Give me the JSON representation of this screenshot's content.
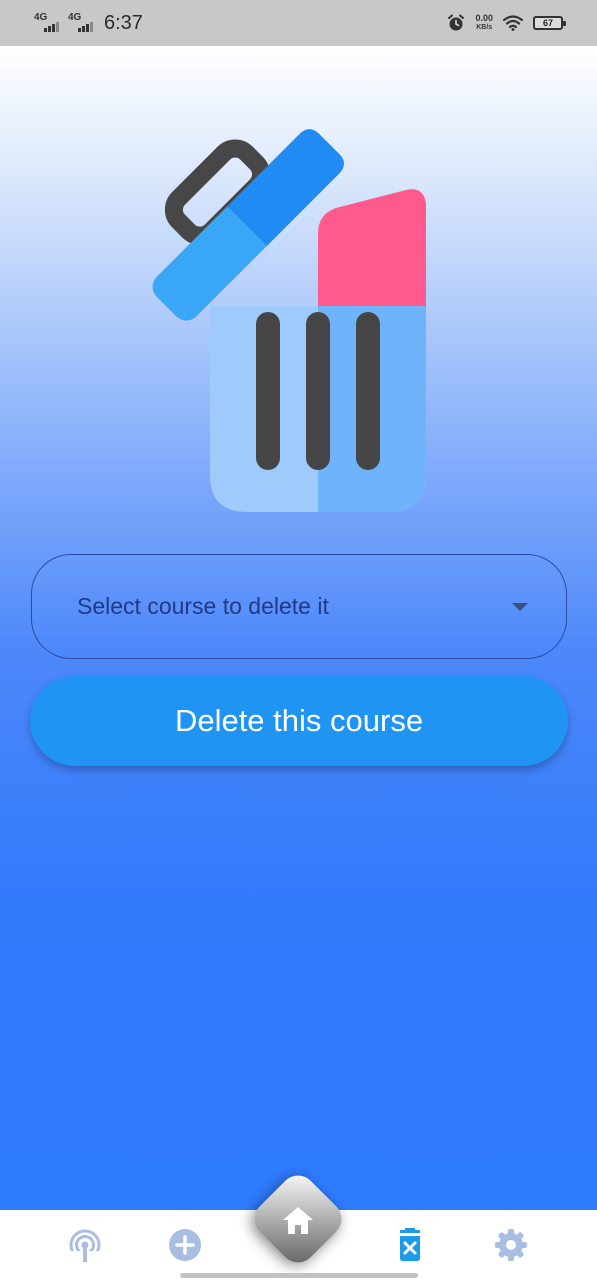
{
  "status_bar": {
    "network1": "4G",
    "network2": "4G",
    "time": "6:37",
    "speed_value": "0.00",
    "speed_unit": "KB/s",
    "battery": "67"
  },
  "illustration": {
    "icon": "trash-bin-open-icon"
  },
  "course_select": {
    "placeholder": "Select course to delete it"
  },
  "delete_button": {
    "label": "Delete this course"
  },
  "bottom_nav": {
    "items": [
      {
        "icon": "broadcast-icon"
      },
      {
        "icon": "add-circle-icon"
      },
      {
        "icon": "home-icon"
      },
      {
        "icon": "delete-icon"
      },
      {
        "icon": "settings-icon"
      }
    ]
  },
  "colors": {
    "accent": "#2094f3",
    "nav_icon_inactive": "#a9bde3",
    "nav_icon_active": "#1e9be6",
    "trash_lid": "#1f8bf3",
    "trash_lid_light": "#3aa6f8",
    "trash_body": "#9fcbfc",
    "trash_body_dark": "#6fb4fb",
    "trash_stripes": "#454545",
    "paper_pink": "#ff5a8e"
  }
}
